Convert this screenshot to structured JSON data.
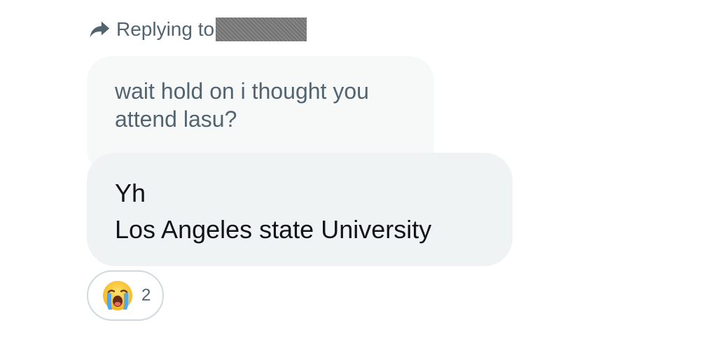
{
  "reply_header": {
    "prefix": "Replying to",
    "icon": "reply-arrow-icon"
  },
  "quoted_message": {
    "lines": [
      "wait hold on i thought you",
      "attend lasu?"
    ]
  },
  "message": {
    "lines": [
      "Yh",
      "Los Angeles state University"
    ]
  },
  "reaction": {
    "emoji": "loudly-crying-face-icon",
    "count": "2"
  },
  "colors": {
    "secondary_text": "#536471",
    "primary_text": "#0f1419",
    "quoted_bubble_bg": "#f7f9f9",
    "message_bubble_bg": "#eff3f4",
    "pill_border": "#cfd9de"
  }
}
